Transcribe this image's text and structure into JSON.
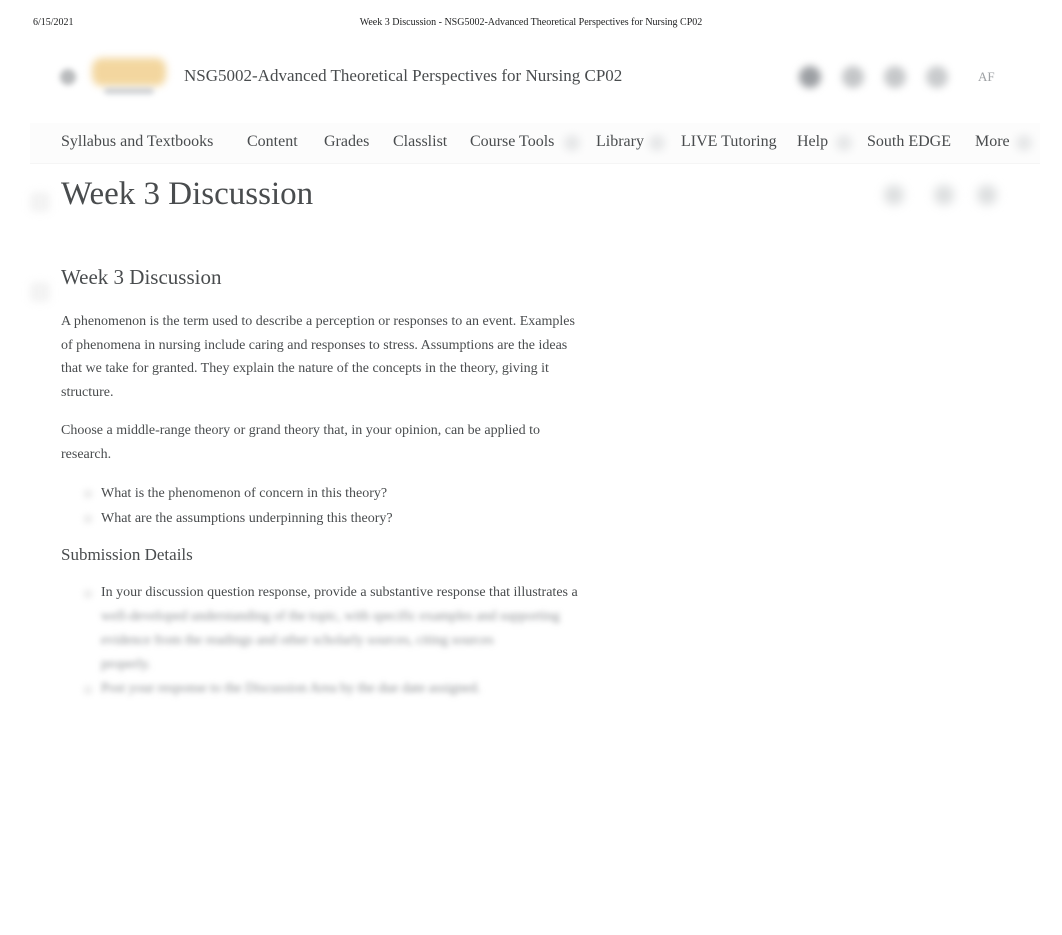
{
  "print_header": {
    "date": "6/15/2021",
    "title": "Week 3 Discussion - NSG5002-Advanced Theoretical Perspectives for Nursing CP02"
  },
  "minibar": {
    "course_title": "NSG5002-Advanced Theoretical Perspectives for Nursing CP02",
    "user_initials": "AF",
    "icons": [
      "grid-icon",
      "mail-icon",
      "message-icon",
      "bell-icon",
      "person-icon"
    ]
  },
  "navbar": {
    "items": [
      {
        "label": "Syllabus and Textbooks"
      },
      {
        "label": "Content"
      },
      {
        "label": "Grades"
      },
      {
        "label": "Classlist"
      },
      {
        "label": "Course Tools"
      },
      {
        "label": "Library"
      },
      {
        "label": "LIVE Tutoring"
      },
      {
        "label": "Help"
      },
      {
        "label": "South EDGE"
      },
      {
        "label": "More"
      }
    ]
  },
  "page": {
    "title": "Week 3 Discussion"
  },
  "content": {
    "heading": "Week 3 Discussion",
    "paragraph1_lines": [
      "A phenomenon is the term used to describe a perception or responses to an event. Examples",
      "of phenomena in nursing include caring and responses to stress. Assumptions are the ideas",
      "that we take for granted. They explain the nature of the concepts in the theory, giving it",
      "structure."
    ],
    "paragraph2_lines": [
      "Choose a middle-range theory or grand theory that, in your opinion, can be applied to",
      "research."
    ],
    "questions": [
      "What is the phenomenon of concern in this theory?",
      "What are the assumptions underpinning this theory?"
    ],
    "submission_heading": "Submission Details",
    "submission_items": [
      {
        "visible_line": "In your discussion question response, provide a substantive response that illustrates a",
        "blurred_lines": [
          "well-developed understanding of the topic, with specific examples and supporting",
          "evidence from the readings and other scholarly sources, citing sources",
          "properly."
        ]
      },
      {
        "visible_line": "",
        "blurred_lines": [
          "Post your response to the Discussion Area by the due date assigned."
        ]
      }
    ]
  }
}
